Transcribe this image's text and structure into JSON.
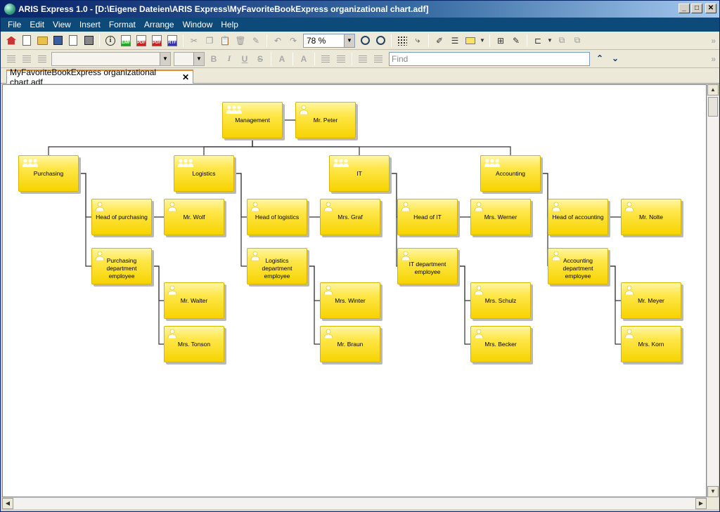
{
  "window": {
    "title": "ARIS Express 1.0 - [D:\\Eigene Dateien\\ARIS Express\\MyFavoriteBookExpress organizational chart.adf]"
  },
  "menu": [
    "File",
    "Edit",
    "View",
    "Insert",
    "Format",
    "Arrange",
    "Window",
    "Help"
  ],
  "toolbar": {
    "zoom_value": "78 %",
    "export_badges": {
      "emf": "EMF",
      "pdf": "PDF",
      "rtf": "RTF"
    },
    "info_glyph": "i"
  },
  "format_toolbar": {
    "font_name": "",
    "font_size": "",
    "bold": "B",
    "italic": "I",
    "underline": "U",
    "strike": "S",
    "font_color": "A",
    "clear_format": "A",
    "find_placeholder": "Find"
  },
  "tabs": [
    {
      "label": "MyFavoriteBookExpress organizational chart.adf"
    }
  ],
  "colors": {
    "node_fill": "#ffe74a",
    "node_border": "#d7b500",
    "accent": "#0d4a7a"
  },
  "org_chart": {
    "nodes": [
      {
        "id": "management",
        "label": "Management",
        "kind": "unit"
      },
      {
        "id": "mr_peter",
        "label": "Mr. Peter",
        "kind": "person"
      },
      {
        "id": "purchasing",
        "label": "Purchasing",
        "kind": "unit"
      },
      {
        "id": "logistics",
        "label": "Logistics",
        "kind": "unit"
      },
      {
        "id": "it",
        "label": "IT",
        "kind": "unit"
      },
      {
        "id": "accounting",
        "label": "Accounting",
        "kind": "unit"
      },
      {
        "id": "head_purchasing",
        "label": "Head of purchasing",
        "kind": "person"
      },
      {
        "id": "mr_wolf",
        "label": "Mr. Wolf",
        "kind": "person"
      },
      {
        "id": "purch_emp",
        "label": "Purchasing department employee",
        "kind": "person"
      },
      {
        "id": "mr_walter",
        "label": "Mr. Walter",
        "kind": "person"
      },
      {
        "id": "mrs_tonson",
        "label": "Mrs. Tonson",
        "kind": "person"
      },
      {
        "id": "head_logistics",
        "label": "Head of logistics",
        "kind": "person"
      },
      {
        "id": "mrs_graf",
        "label": "Mrs. Graf",
        "kind": "person"
      },
      {
        "id": "log_emp",
        "label": "Logistics department employee",
        "kind": "person"
      },
      {
        "id": "mrs_winter",
        "label": "Mrs. Winter",
        "kind": "person"
      },
      {
        "id": "mr_braun",
        "label": "Mr. Braun",
        "kind": "person"
      },
      {
        "id": "head_it",
        "label": "Head of IT",
        "kind": "person"
      },
      {
        "id": "mrs_werner",
        "label": "Mrs. Werner",
        "kind": "person"
      },
      {
        "id": "it_emp",
        "label": "IT department employee",
        "kind": "person"
      },
      {
        "id": "mrs_schulz",
        "label": "Mrs. Schulz",
        "kind": "person"
      },
      {
        "id": "mrs_becker",
        "label": "Mrs. Becker",
        "kind": "person"
      },
      {
        "id": "head_accounting",
        "label": "Head of accounting",
        "kind": "person"
      },
      {
        "id": "mr_nolte",
        "label": "Mr. Nolte",
        "kind": "person"
      },
      {
        "id": "acc_emp",
        "label": "Accounting department employee",
        "kind": "person"
      },
      {
        "id": "mr_meyer",
        "label": "Mr. Meyer",
        "kind": "person"
      },
      {
        "id": "mrs_korn",
        "label": "Mrs. Korn",
        "kind": "person"
      }
    ],
    "edges": [
      [
        "management",
        "mr_peter"
      ],
      [
        "management",
        "purchasing"
      ],
      [
        "management",
        "logistics"
      ],
      [
        "management",
        "it"
      ],
      [
        "management",
        "accounting"
      ],
      [
        "purchasing",
        "head_purchasing"
      ],
      [
        "head_purchasing",
        "mr_wolf"
      ],
      [
        "purchasing",
        "purch_emp"
      ],
      [
        "purch_emp",
        "mr_walter"
      ],
      [
        "purch_emp",
        "mrs_tonson"
      ],
      [
        "logistics",
        "head_logistics"
      ],
      [
        "head_logistics",
        "mrs_graf"
      ],
      [
        "logistics",
        "log_emp"
      ],
      [
        "log_emp",
        "mrs_winter"
      ],
      [
        "log_emp",
        "mr_braun"
      ],
      [
        "it",
        "head_it"
      ],
      [
        "head_it",
        "mrs_werner"
      ],
      [
        "it",
        "it_emp"
      ],
      [
        "it_emp",
        "mrs_schulz"
      ],
      [
        "it_emp",
        "mrs_becker"
      ],
      [
        "accounting",
        "head_accounting"
      ],
      [
        "head_accounting",
        "mr_nolte"
      ],
      [
        "accounting",
        "acc_emp"
      ],
      [
        "acc_emp",
        "mr_meyer"
      ],
      [
        "acc_emp",
        "mrs_korn"
      ]
    ]
  }
}
